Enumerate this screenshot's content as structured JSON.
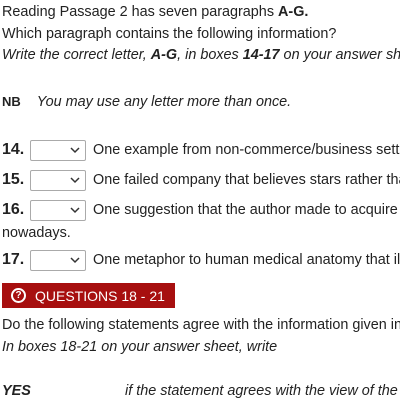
{
  "instructions": {
    "line1_pre": "Reading Passage 2 has seven paragraphs ",
    "line1_bold": "A-G.",
    "line2": "Which paragraph contains the following information?",
    "line3_pre": "Write the correct letter, ",
    "line3_b1": "A-G",
    "line3_mid": ", in boxes ",
    "line3_b2": "14-17",
    "line3_post": " on your answer she"
  },
  "nb": {
    "label": "NB",
    "text": "You may use any letter more than once."
  },
  "questions": [
    {
      "number": "14.",
      "text": "One example from non-commerce/business setti"
    },
    {
      "number": "15.",
      "text": "One failed company that believes stars rather tha"
    },
    {
      "number": "16.",
      "text": "One suggestion that the author made to acquire",
      "continuation": "nowadays."
    },
    {
      "number": "17.",
      "text": "One metaphor to human medical anatomy that ill"
    }
  ],
  "section": {
    "icon": "question-circle-icon",
    "title": "QUESTIONS 18 - 21",
    "color": "#a70f0f"
  },
  "section_text": {
    "line1": "Do the following statements agree with the information given in",
    "line2": "In boxes 18-21 on your answer sheet, write"
  },
  "answers": [
    {
      "key": "YES",
      "text": "if the statement agrees with the view of the w"
    }
  ]
}
